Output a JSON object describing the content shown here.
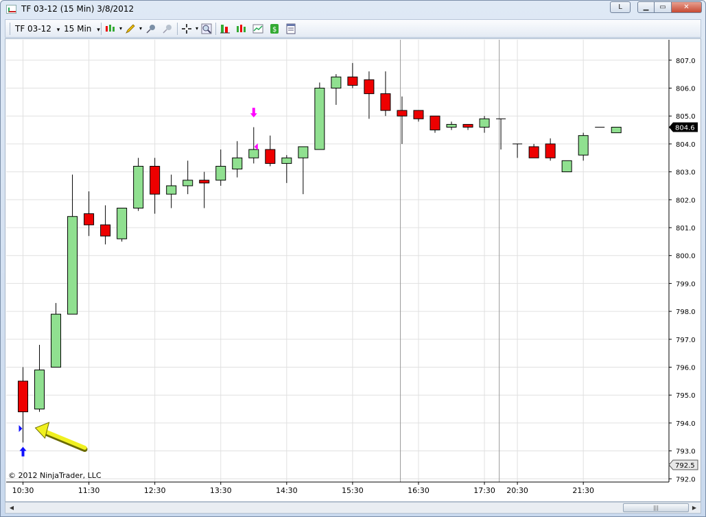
{
  "window": {
    "title": "TF 03-12 (15 Min)  3/8/2012",
    "buttons": {
      "layout": "L",
      "minimize": "▁",
      "maximize": "▭",
      "close": "✕"
    }
  },
  "toolbar": {
    "instrument": "TF 03-12",
    "interval": "15 Min",
    "dropdown_glyph": "▾"
  },
  "copyright": "© 2012 NinjaTrader, LLC",
  "colors": {
    "up": "#90e090",
    "down": "#ee0000",
    "grid": "#e0e0e0",
    "session_line": "#999999",
    "marker": "#ff00ff",
    "entry": "#1010ff",
    "arrow": "#f0f020"
  },
  "chart_data": {
    "type": "candlestick",
    "ylim": [
      792.0,
      807.3
    ],
    "y_ticks": [
      "792.0",
      "793.0",
      "794.0",
      "795.0",
      "796.0",
      "797.0",
      "798.0",
      "799.0",
      "800.0",
      "801.0",
      "802.0",
      "803.0",
      "804.0",
      "805.0",
      "806.0",
      "807.0"
    ],
    "x_labels": [
      {
        "label": "10:30",
        "bar": 0
      },
      {
        "label": "11:30",
        "bar": 4
      },
      {
        "label": "12:30",
        "bar": 8
      },
      {
        "label": "13:30",
        "bar": 12
      },
      {
        "label": "14:30",
        "bar": 16
      },
      {
        "label": "15:30",
        "bar": 20
      },
      {
        "label": "16:30",
        "bar": 24
      },
      {
        "label": "17:30",
        "bar": 28
      },
      {
        "label": "20:30",
        "bar": 30
      },
      {
        "label": "21:30",
        "bar": 34
      }
    ],
    "session_breaks": [
      22.9,
      28.9
    ],
    "bars": [
      {
        "o": 795.5,
        "h": 796.0,
        "l": 793.3,
        "c": 794.4
      },
      {
        "o": 794.5,
        "h": 796.8,
        "l": 794.4,
        "c": 795.9
      },
      {
        "o": 796.0,
        "h": 798.3,
        "l": 796.0,
        "c": 797.9
      },
      {
        "o": 797.9,
        "h": 802.9,
        "l": 797.9,
        "c": 801.4
      },
      {
        "o": 801.5,
        "h": 802.3,
        "l": 800.7,
        "c": 801.1
      },
      {
        "o": 801.1,
        "h": 801.8,
        "l": 800.4,
        "c": 800.7
      },
      {
        "o": 800.6,
        "h": 801.7,
        "l": 800.5,
        "c": 801.7
      },
      {
        "o": 801.7,
        "h": 803.5,
        "l": 801.6,
        "c": 803.2
      },
      {
        "o": 803.2,
        "h": 803.5,
        "l": 801.5,
        "c": 802.2
      },
      {
        "o": 802.2,
        "h": 802.9,
        "l": 801.7,
        "c": 802.5
      },
      {
        "o": 802.5,
        "h": 803.4,
        "l": 802.2,
        "c": 802.7
      },
      {
        "o": 802.7,
        "h": 803.0,
        "l": 801.7,
        "c": 802.6
      },
      {
        "o": 802.7,
        "h": 803.8,
        "l": 802.5,
        "c": 803.2
      },
      {
        "o": 803.1,
        "h": 804.1,
        "l": 802.8,
        "c": 803.5
      },
      {
        "o": 803.5,
        "h": 804.6,
        "l": 803.3,
        "c": 803.8
      },
      {
        "o": 803.8,
        "h": 804.3,
        "l": 803.2,
        "c": 803.3
      },
      {
        "o": 803.3,
        "h": 803.6,
        "l": 802.6,
        "c": 803.5
      },
      {
        "o": 803.5,
        "h": 803.9,
        "l": 802.2,
        "c": 803.9
      },
      {
        "o": 803.8,
        "h": 806.2,
        "l": 803.8,
        "c": 806.0
      },
      {
        "o": 806.0,
        "h": 806.5,
        "l": 805.4,
        "c": 806.4
      },
      {
        "o": 806.4,
        "h": 806.9,
        "l": 806.0,
        "c": 806.1
      },
      {
        "o": 806.3,
        "h": 806.6,
        "l": 804.9,
        "c": 805.8
      },
      {
        "o": 805.8,
        "h": 806.6,
        "l": 805.0,
        "c": 805.2
      },
      {
        "o": 805.2,
        "h": 805.7,
        "l": 804.0,
        "c": 805.0
      },
      {
        "o": 805.2,
        "h": 805.2,
        "l": 804.8,
        "c": 804.9
      },
      {
        "o": 805.0,
        "h": 805.0,
        "l": 804.4,
        "c": 804.5
      },
      {
        "o": 804.6,
        "h": 804.8,
        "l": 804.5,
        "c": 804.7
      },
      {
        "o": 804.7,
        "h": 804.7,
        "l": 804.5,
        "c": 804.6
      },
      {
        "o": 804.6,
        "h": 805.0,
        "l": 804.4,
        "c": 804.9
      },
      {
        "o": 804.9,
        "h": 804.9,
        "l": 803.8,
        "c": 804.9
      },
      {
        "o": 804.0,
        "h": 804.0,
        "l": 803.5,
        "c": 804.0
      },
      {
        "o": 803.9,
        "h": 804.0,
        "l": 803.5,
        "c": 803.5
      },
      {
        "o": 804.0,
        "h": 804.2,
        "l": 803.4,
        "c": 803.5
      },
      {
        "o": 803.0,
        "h": 803.4,
        "l": 803.0,
        "c": 803.4
      },
      {
        "o": 803.6,
        "h": 804.4,
        "l": 803.4,
        "c": 804.3
      },
      {
        "o": 804.6,
        "h": 804.6,
        "l": 804.6,
        "c": 804.6
      },
      {
        "o": 804.4,
        "h": 804.6,
        "l": 804.4,
        "c": 804.6
      }
    ],
    "last_price": "804.6",
    "min_marker": "792.5",
    "signals": [
      {
        "type": "short",
        "bar": 14,
        "price": 805.0
      },
      {
        "type": "long",
        "bar": 0,
        "price": 793.0
      }
    ],
    "fills": [
      {
        "type": "entry",
        "bar": 0,
        "price": 793.8
      },
      {
        "type": "exit",
        "bar": 14,
        "price": 803.9
      }
    ]
  }
}
